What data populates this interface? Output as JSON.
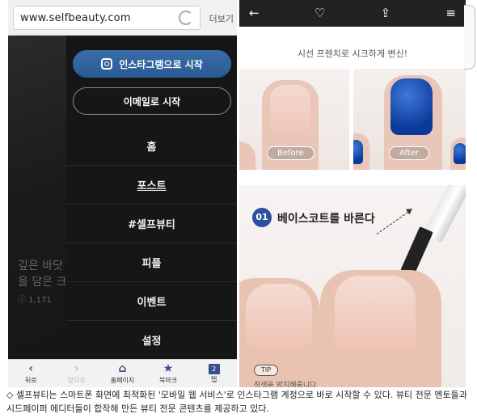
{
  "left_phone": {
    "url": "www.selfbeauty.com",
    "more_label": "더보기",
    "background_article": {
      "title_line1": "깊은 바닷",
      "title_line2": "을 담은 크",
      "count": "ⓘ 1,171"
    },
    "menu": {
      "instagram_button": "인스타그램으로 시작",
      "email_button": "이메일로 시작",
      "items": [
        "홈",
        "포스트",
        "#셀프뷰티",
        "피플",
        "이벤트",
        "설정"
      ]
    },
    "bottom_bar": [
      {
        "icon": "back-arrow-icon",
        "glyph": "‹",
        "label": "뒤로"
      },
      {
        "icon": "forward-arrow-icon",
        "glyph": "›",
        "label": "앞으로"
      },
      {
        "icon": "home-icon",
        "glyph": "⌂",
        "label": "홈페이지"
      },
      {
        "icon": "bookmark-icon",
        "glyph": "★",
        "label": "북마크"
      },
      {
        "icon": "tabs-icon",
        "glyph": "2",
        "label": "탭"
      }
    ]
  },
  "right_phone": {
    "subtitle": "시선 프렌치로 시크하게 변신!",
    "before_label": "Before",
    "after_label": "After",
    "step_number": "01",
    "step_text": "베이스코트를 바른다",
    "tip_label": "TIP",
    "tip_text": "착색을 방지해줍니다"
  },
  "colors": {
    "instagram_button": "#2a5a93",
    "menu_background": "#161616",
    "step_badge": "#2d4fa0",
    "nail_blue": "#0b3a9a"
  },
  "caption": "◇ 셀프뷰티는 스마트폰 화면에 최적화된 '모바일 웹 서비스'로 인스타그램 계정으로 바로 시작할 수 있다. 뷰티 전문 멘토들과 시드페이퍼 에디터들이 합작해 만든 뷰티 전문 콘텐츠를 제공하고 있다."
}
